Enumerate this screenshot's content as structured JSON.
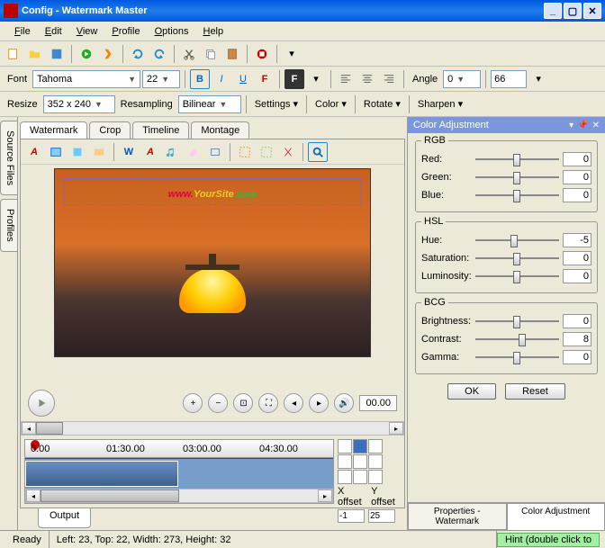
{
  "title": "Config - Watermark Master",
  "menu": {
    "file": "File",
    "edit": "Edit",
    "view": "View",
    "profile": "Profile",
    "options": "Options",
    "help": "Help"
  },
  "font": {
    "label": "Font",
    "family": "Tahoma",
    "size": "22"
  },
  "angle": {
    "label": "Angle",
    "value": "0",
    "second": "66"
  },
  "resize": {
    "label": "Resize",
    "dims": "352 x 240",
    "resampling_label": "Resampling",
    "resampling": "Bilinear",
    "settings": "Settings",
    "color": "Color",
    "rotate": "Rotate",
    "sharpen": "Sharpen"
  },
  "sidetabs": {
    "sources": "Source Files",
    "profiles": "Profiles"
  },
  "tabs": {
    "watermark": "Watermark",
    "crop": "Crop",
    "timeline": "Timeline",
    "montage": "Montage"
  },
  "watermark_text": {
    "p1": "www.",
    "p2": "YourSite",
    "p3": ".com"
  },
  "timecode": "00.00",
  "ruler": {
    "t0": "0.00",
    "t1": "01:30.00",
    "t2": "03:00.00",
    "t3": "04:30.00"
  },
  "offsets": {
    "x_label": "X offset",
    "y_label": "Y offset",
    "x": "-1",
    "y": "25"
  },
  "panel": {
    "title": "Color Adjustment",
    "rgb": {
      "title": "RGB",
      "red_label": "Red:",
      "red": "0",
      "green_label": "Green:",
      "green": "0",
      "blue_label": "Blue:",
      "blue": "0"
    },
    "hsl": {
      "title": "HSL",
      "hue_label": "Hue:",
      "hue": "-5",
      "sat_label": "Saturation:",
      "sat": "0",
      "lum_label": "Luminosity:",
      "lum": "0"
    },
    "bcg": {
      "title": "BCG",
      "bright_label": "Brightness:",
      "bright": "0",
      "contrast_label": "Contrast:",
      "contrast": "8",
      "gamma_label": "Gamma:",
      "gamma": "0"
    },
    "ok": "OK",
    "reset": "Reset",
    "tab_props": "Properties - Watermark",
    "tab_color": "Color Adjustment"
  },
  "bottom_tab": "Output",
  "status": {
    "ready": "Ready",
    "coords": "Left: 23, Top: 22, Width: 273, Height: 32",
    "hint": "Hint (double click to"
  }
}
